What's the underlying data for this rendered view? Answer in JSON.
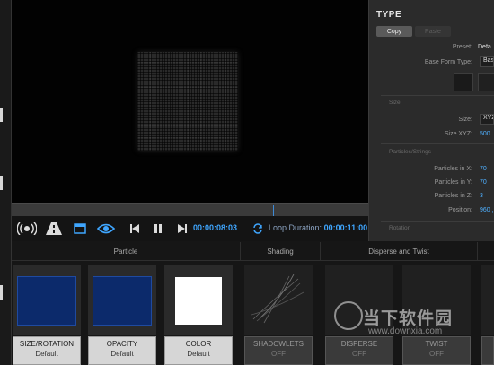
{
  "playback": {
    "current_time": "00:00:08:03",
    "loop_label": "Loop Duration:",
    "loop_time": "00:00:11:00"
  },
  "panel": {
    "title": "TYPE",
    "segment_copy": "Copy",
    "segment_paste": "Paste",
    "preset_label": "Preset:",
    "preset_value": "Defa",
    "base_form_label": "Base Form Type:",
    "base_form_value": "Base",
    "section_size": "Size",
    "size_label": "Size:",
    "size_value": "XYZ",
    "size_xyz_label": "Size XYZ:",
    "size_xyz_value": "500",
    "section_particles": "Particles/Strings",
    "px_label": "Particles in X:",
    "px_value": "70",
    "py_label": "Particles in Y:",
    "py_value": "70",
    "pz_label": "Particles in Z:",
    "pz_value": "3",
    "position_label": "Position:",
    "position_value": "960 ,",
    "section_rotation": "Rotation"
  },
  "modules": {
    "headers": {
      "particle": "Particle",
      "shading": "Shading",
      "disperse_twist": "Disperse and Twist"
    },
    "cards": [
      {
        "title": "SIZE/ROTATION",
        "sub": "Default",
        "swatch": "#0c2a6b"
      },
      {
        "title": "OPACITY",
        "sub": "Default",
        "swatch": "#0c2a6b"
      },
      {
        "title": "COLOR",
        "sub": "Default",
        "swatch": "#ffffff"
      },
      {
        "title": "SHADOWLETS",
        "sub": "OFF"
      },
      {
        "title": "DISPERSE",
        "sub": "OFF"
      },
      {
        "title": "TWIST",
        "sub": "OFF"
      }
    ]
  },
  "watermark": {
    "main": "当下软件园",
    "sub": "www.downxia.com"
  },
  "colors": {
    "accent_blue": "#3fa6ff",
    "swatch_blue": "#0c2a6b"
  }
}
